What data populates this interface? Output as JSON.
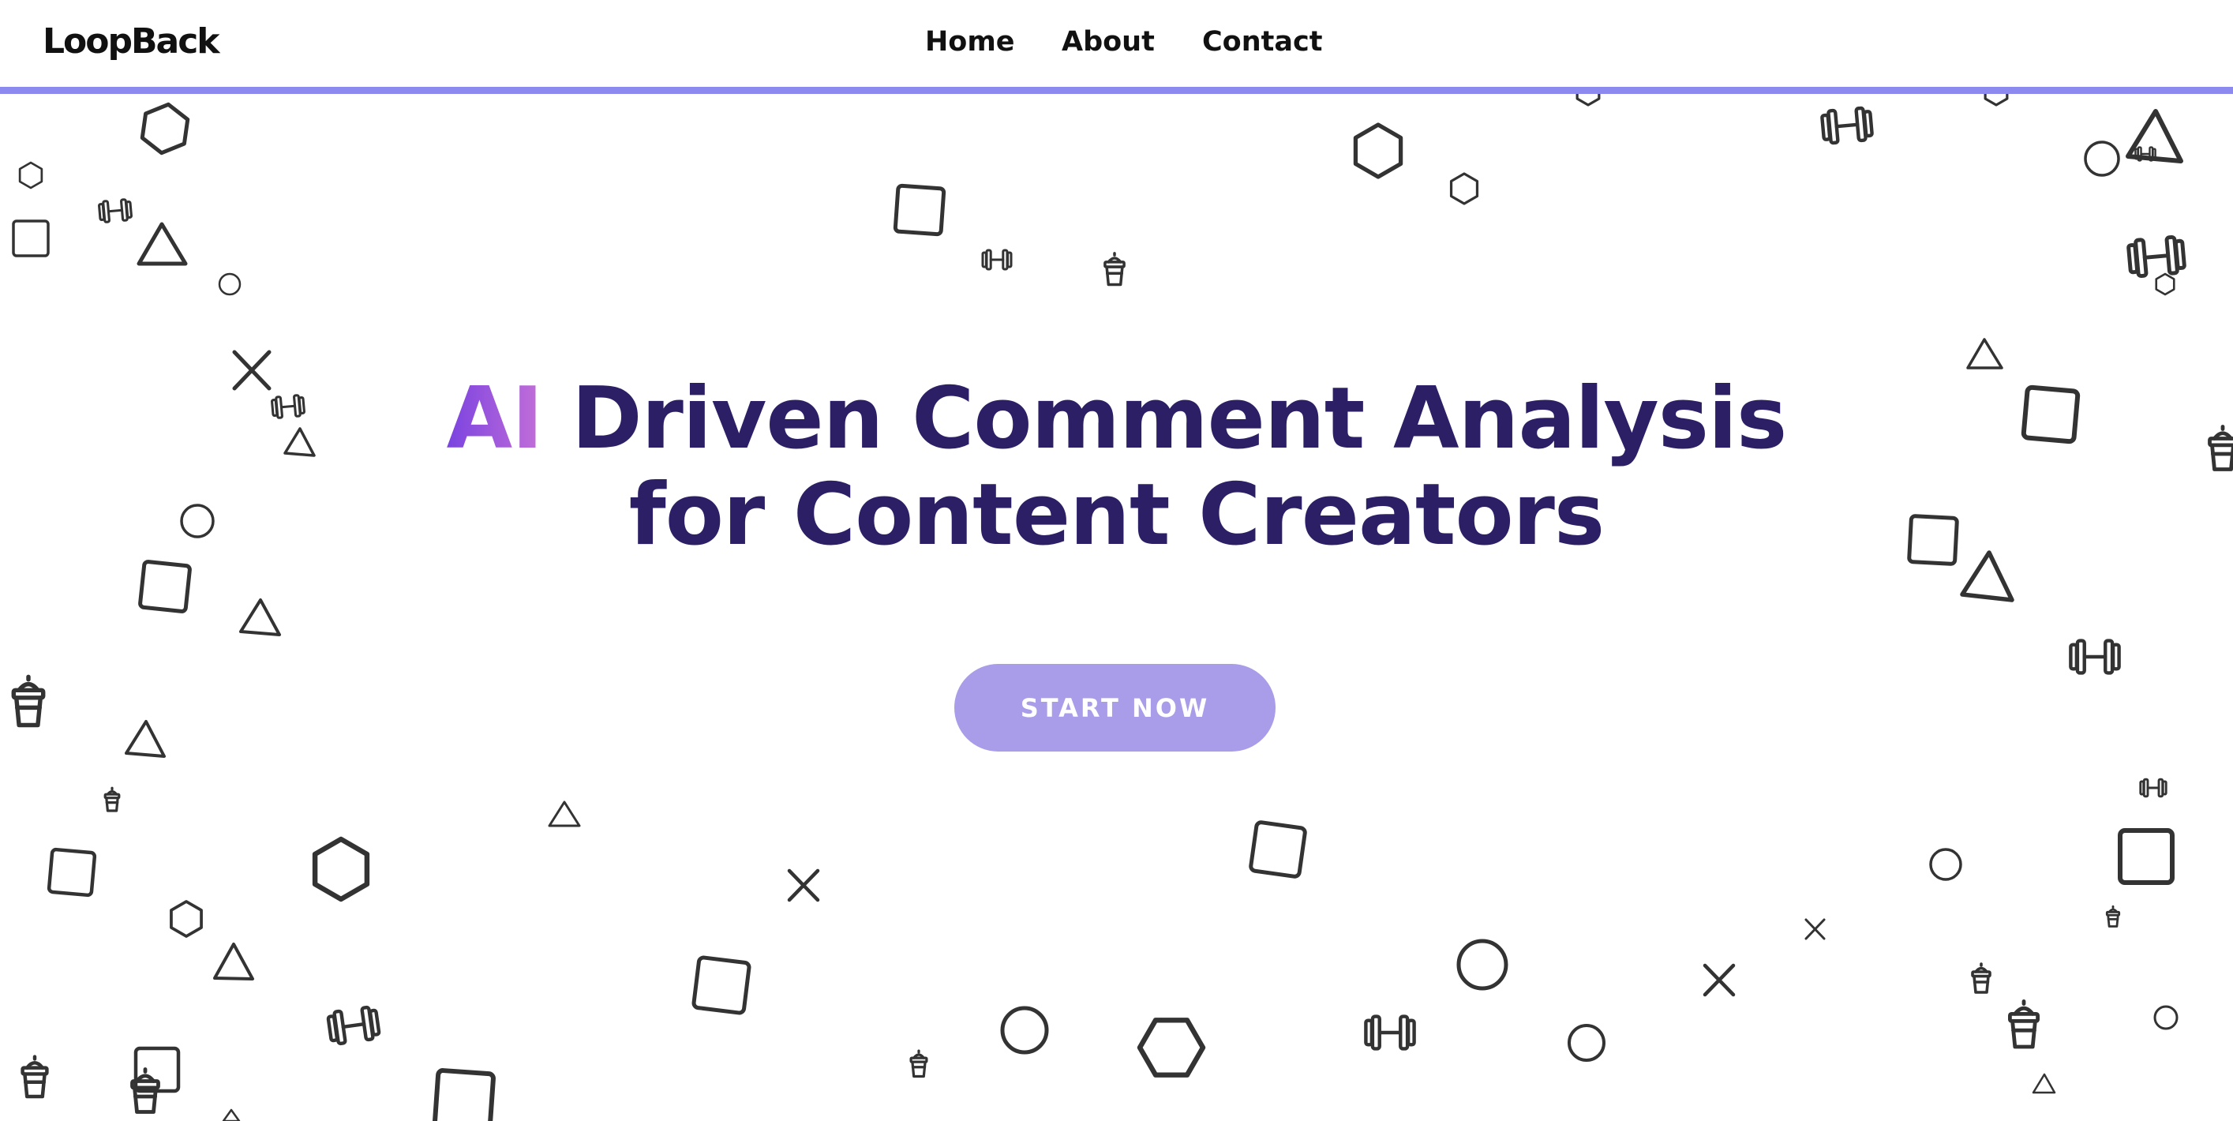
{
  "brand": {
    "logo_text": "LoopBack"
  },
  "nav": {
    "links": [
      {
        "label": "Home"
      },
      {
        "label": "About"
      },
      {
        "label": "Contact"
      }
    ],
    "accent_color": "#8c8aee"
  },
  "hero": {
    "highlight": "AI",
    "title_line1_rest": " Driven Comment Analysis",
    "title_line2": "for Content Creators",
    "title_color": "#2c1f66",
    "highlight_gradient": [
      "#7a43e0",
      "#c46fd8"
    ]
  },
  "cta": {
    "label": "START NOW",
    "color": "#a99ce8"
  },
  "background": {
    "icon_types": [
      "hexagon-icon",
      "square-icon",
      "triangle-icon",
      "circle-icon",
      "cross-icon",
      "dumbbell-icon",
      "cup-icon"
    ],
    "stroke_color": "#333333"
  }
}
